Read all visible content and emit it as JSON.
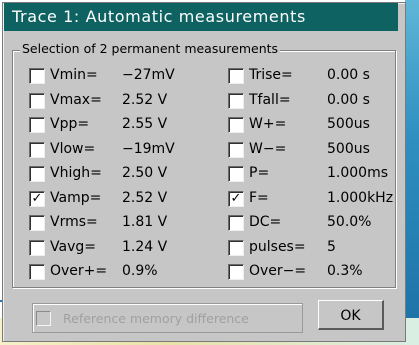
{
  "title": "Trace 1: Automatic measurements",
  "group_title": "Selection of 2 permanent measurements",
  "left_measurements": [
    {
      "label": "Vmin=",
      "value": "−27mV",
      "checked": false
    },
    {
      "label": "Vmax=",
      "value": "2.52 V",
      "checked": false
    },
    {
      "label": "Vpp=",
      "value": "2.55 V",
      "checked": false
    },
    {
      "label": "Vlow=",
      "value": "−19mV",
      "checked": false
    },
    {
      "label": "Vhigh=",
      "value": "2.50 V",
      "checked": false
    },
    {
      "label": "Vamp=",
      "value": "2.52 V",
      "checked": true
    },
    {
      "label": "Vrms=",
      "value": "1.81 V",
      "checked": false
    },
    {
      "label": "Vavg=",
      "value": "1.24 V",
      "checked": false
    },
    {
      "label": "Over+=",
      "value": "0.9%",
      "checked": false
    }
  ],
  "right_measurements": [
    {
      "label": "Trise=",
      "value": "0.00 s",
      "checked": false
    },
    {
      "label": "Tfall=",
      "value": "0.00 s",
      "checked": false
    },
    {
      "label": "W+=",
      "value": "500us",
      "checked": false
    },
    {
      "label": "W−=",
      "value": "500us",
      "checked": false
    },
    {
      "label": "P=",
      "value": "1.000ms",
      "checked": false
    },
    {
      "label": "F=",
      "value": "1.000kHz",
      "checked": true
    },
    {
      "label": "DC=",
      "value": "50.0%",
      "checked": false
    },
    {
      "label": "pulses=",
      "value": "5",
      "checked": false
    },
    {
      "label": "Over−=",
      "value": "0.3%",
      "checked": false
    }
  ],
  "reference_memory_label": "Reference memory difference",
  "reference_memory_enabled": false,
  "ok_label": "OK",
  "check_glyph": "✓"
}
